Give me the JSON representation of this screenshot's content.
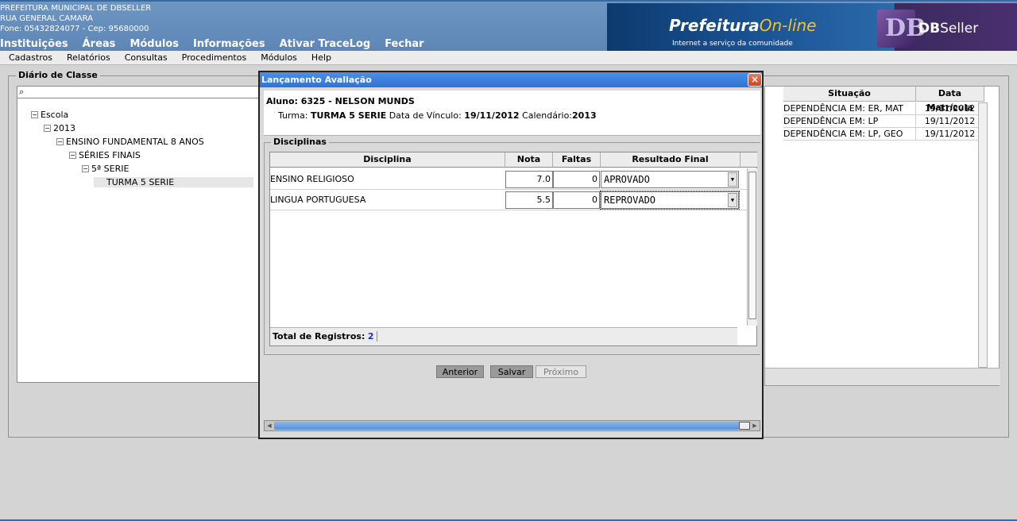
{
  "header": {
    "org": "PREFEITURA MUNICIPAL DE DBSELLER",
    "address": "RUA GENERAL CAMARA",
    "phone": "Fone: 05432824077  -  Cep: 95680000",
    "menu": [
      "Instituições",
      "Áreas",
      "Módulos",
      "Informações",
      "Ativar TraceLog",
      "Fechar"
    ],
    "banner_brand": "Prefeitura",
    "banner_brand2": "On-line",
    "banner_tagline": "Internet a serviço da comunidade",
    "banner_logo": "DB",
    "banner_company_bold": "DB",
    "banner_company": "Seller"
  },
  "menubar": [
    "Cadastros",
    "Relatórios",
    "Consultas",
    "Procedimentos",
    "Módulos",
    "Help"
  ],
  "diario": {
    "legend": "Diário de Classe",
    "search_icon": "magnifier-icon",
    "tree": [
      "Escola",
      "2013",
      "ENSINO FUNDAMENTAL 8 ANOS",
      "SÉRIES FINAIS",
      "5ª SERIE",
      "TURMA 5 SERIE"
    ]
  },
  "bg_table": {
    "headers": [
      "Situação",
      "Data Matrícula"
    ],
    "rows": [
      [
        "DEPENDÊNCIA EM: ER, MAT",
        "19/11/2012"
      ],
      [
        "DEPENDÊNCIA EM: LP",
        "19/11/2012"
      ],
      [
        "DEPENDÊNCIA EM: LP, GEO",
        "19/11/2012"
      ]
    ]
  },
  "modal": {
    "title": "Lançamento Avaliação",
    "close": "×",
    "aluno": "Aluno: 6325 - NELSON MUNDS",
    "turma_label": "Turma: ",
    "turma_value": "TURMA 5 SERIE",
    "vinculo_label": " Data de Vínculo: ",
    "vinculo_value": "19/11/2012",
    "calendario_label": " Calendário:",
    "calendario_value": "2013",
    "disciplinas_legend": "Disciplinas",
    "grid_headers": [
      "Disciplina",
      "Nota",
      "Faltas",
      "Resultado Final"
    ],
    "grid_rows": [
      {
        "disciplina": "ENSINO RELIGIOSO",
        "nota": "7.0",
        "faltas": "0",
        "resultado": "APROVADO"
      },
      {
        "disciplina": "LINGUA PORTUGUESA",
        "nota": "5.5",
        "faltas": "0",
        "resultado": "REPROVADO"
      }
    ],
    "total_label": "Total de Registros:",
    "total_value": "2",
    "buttons": {
      "anterior": "Anterior",
      "salvar": "Salvar",
      "proximo": "Próximo"
    }
  },
  "colors": {
    "titlebar": "#2f74d6",
    "header": "#5d86b6"
  }
}
